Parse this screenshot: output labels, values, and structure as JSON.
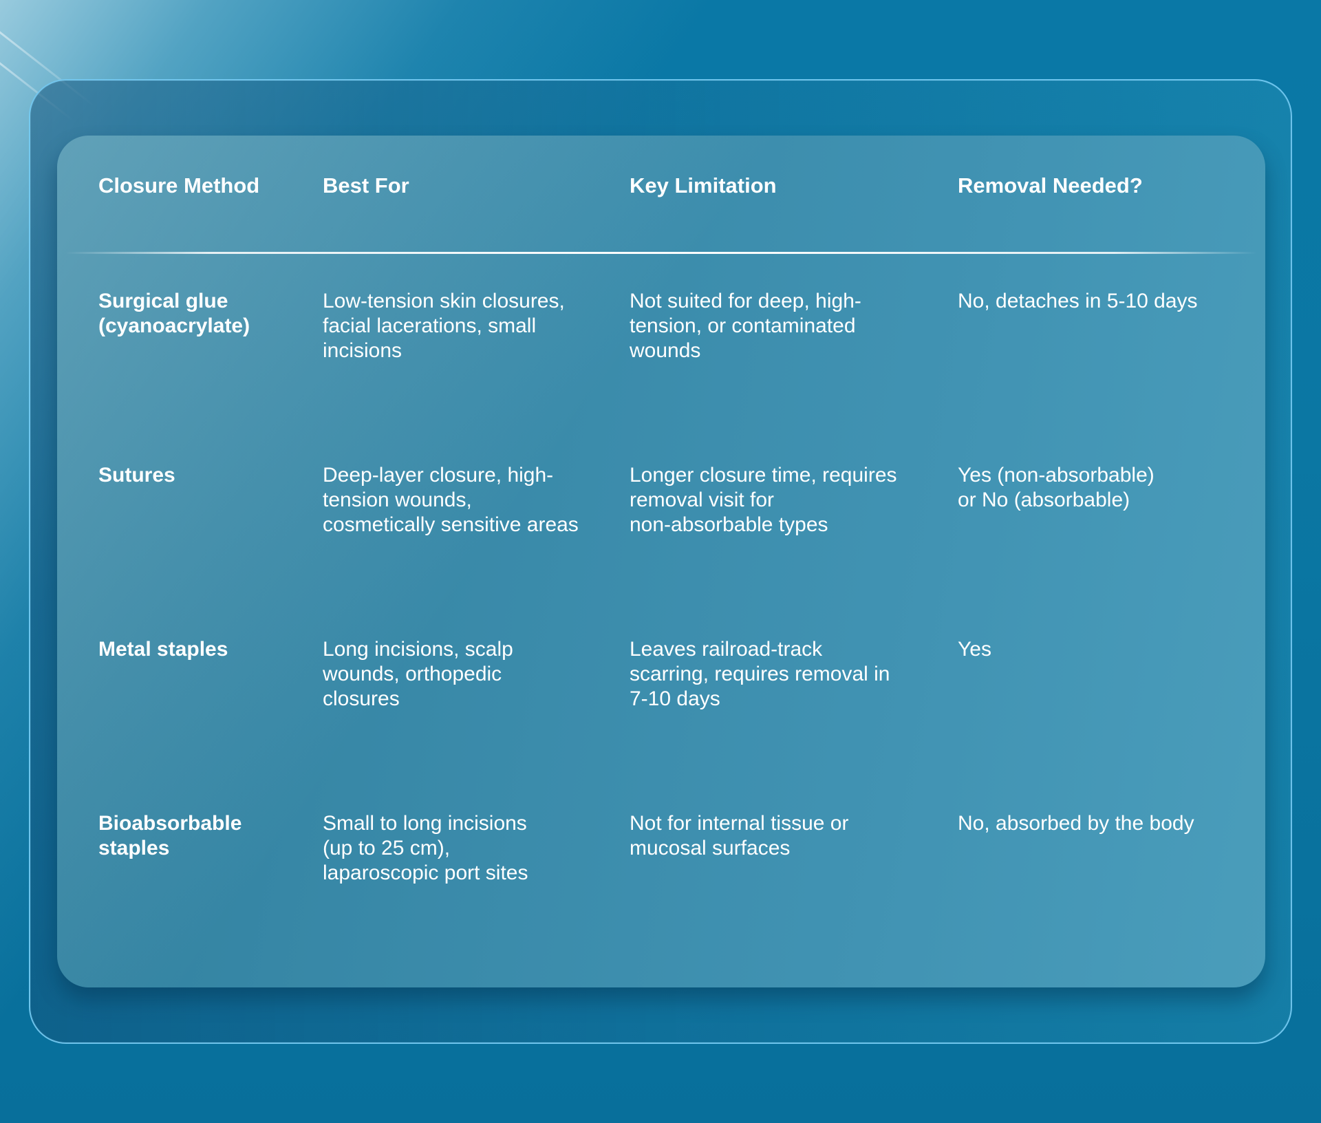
{
  "table": {
    "headers": [
      "Closure Method",
      "Best For",
      "Key Limitation",
      "Removal Needed?"
    ],
    "rows": [
      {
        "method": "Surgical glue\n(cyanoacrylate)",
        "best_for": "Low-tension skin closures,\nfacial lacerations, small\nincisions",
        "limitation": "Not suited for deep, high-\ntension, or contaminated\nwounds",
        "removal": "No, detaches in 5-10 days"
      },
      {
        "method": "Sutures",
        "best_for": "Deep-layer closure, high-\ntension wounds,\ncosmetically sensitive areas",
        "limitation": "Longer closure time, requires\nremoval visit for\nnon-absorbable types",
        "removal": "Yes (non-absorbable)\nor No (absorbable)"
      },
      {
        "method": "Metal staples",
        "best_for": "Long incisions, scalp\nwounds, orthopedic\nclosures",
        "limitation": "Leaves railroad-track\nscarring, requires removal in\n7-10 days",
        "removal": "Yes"
      },
      {
        "method": "Bioabsorbable\nstaples",
        "best_for": "Small to long incisions\n(up to 25 cm),\nlaparoscopic port sites",
        "limitation": "Not for internal tissue or\nmucosal surfaces",
        "removal": "No, absorbed by the body"
      }
    ]
  },
  "colors": {
    "background": "#0a78a6",
    "card": "#3888a7",
    "frame_border": "#78cdf5",
    "text": "#ffffff"
  }
}
